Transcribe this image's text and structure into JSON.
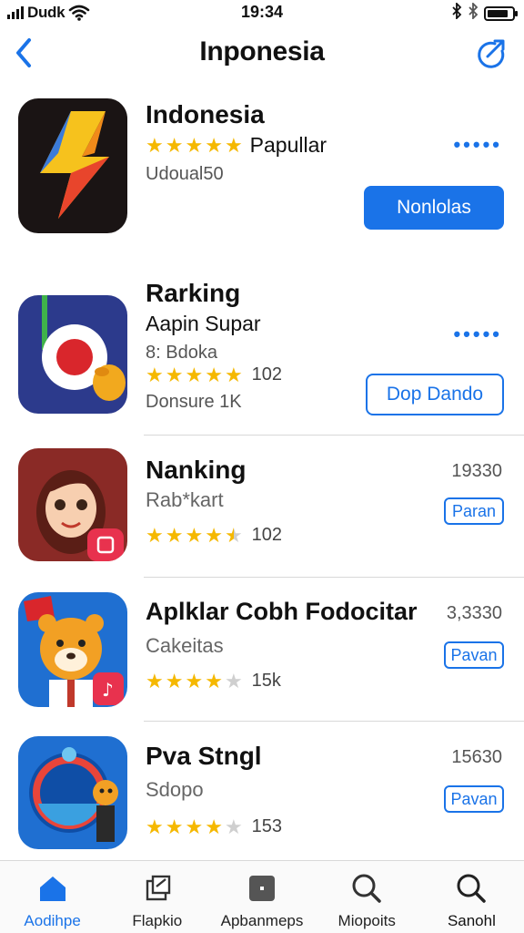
{
  "status_bar": {
    "carrier": "Dudk",
    "time": "19:34",
    "battery_level": 0.85,
    "icons": [
      "signal-icon",
      "wifi-icon",
      "bluetooth-icon",
      "battery-icon"
    ]
  },
  "nav": {
    "title": "Inponesia",
    "back_icon": "chevron-left-icon",
    "share_icon": "share-icon"
  },
  "apps": [
    {
      "title": "Indonesia",
      "rating_label": "Papullar",
      "rating": 5,
      "meta": "Udoual50",
      "more": "•••••",
      "button": "Nonlolas"
    },
    {
      "title": "Rarking",
      "subtitle": "Aapin Supar",
      "meta": "8: Bdoka",
      "rating": 5,
      "rating_count": "102",
      "meta2": "Donsure 1K",
      "more": "•••••",
      "button": "Dop Dando"
    },
    {
      "title": "Nanking",
      "subtitle": "Rab*kart",
      "rating": 4.5,
      "rating_count": "102",
      "price": "19330",
      "button": "Paran"
    },
    {
      "title": "Aplklar Cobh Fodocitar",
      "subtitle": "Cakeitas",
      "rating": 4,
      "rating_count": "15k",
      "price": "3,3330",
      "button": "Pavan"
    },
    {
      "title": "Pva Stngl",
      "subtitle": "Sdopo",
      "rating": 4,
      "rating_count": "153",
      "price": "15630",
      "button": "Pavan"
    }
  ],
  "tabs": [
    {
      "label": "Aodihpe",
      "icon": "home-icon",
      "active": true
    },
    {
      "label": "Flapkio",
      "icon": "apps-icon",
      "active": false
    },
    {
      "label": "Apbanmeps",
      "icon": "games-icon",
      "active": false
    },
    {
      "label": "Miopoits",
      "icon": "search-icon",
      "active": false
    },
    {
      "label": "Sanohl",
      "icon": "search-icon",
      "active": false
    }
  ],
  "colors": {
    "accent": "#1a73e8",
    "star": "#f5b800",
    "star_off": "#cfcfcf"
  }
}
